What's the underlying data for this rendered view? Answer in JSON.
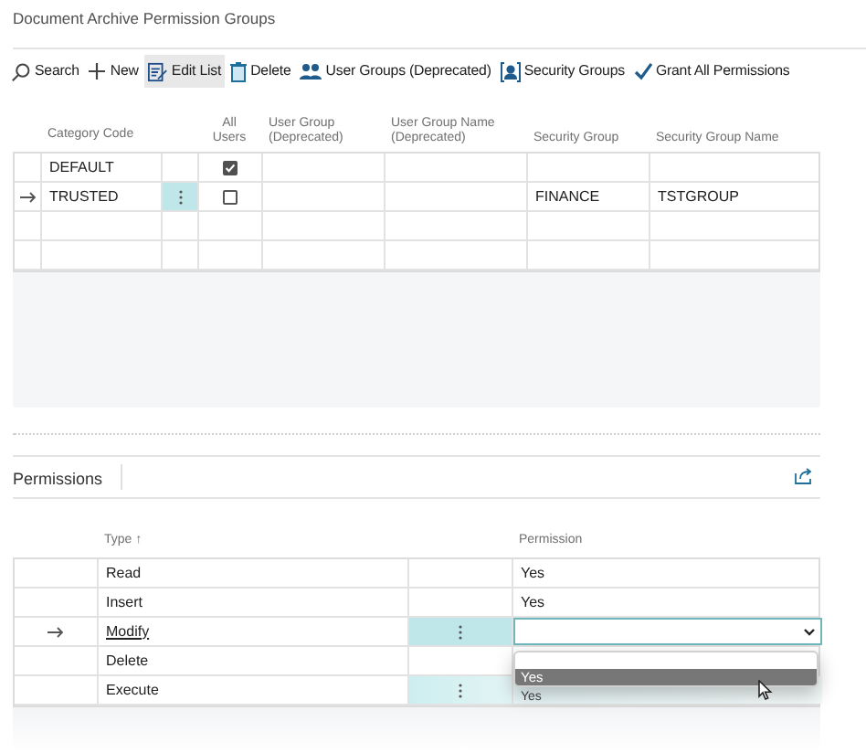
{
  "title": "Document Archive Permission Groups",
  "actions": [
    {
      "label": "Search",
      "selected": false
    },
    {
      "label": "New",
      "selected": false
    },
    {
      "label": "Edit List",
      "selected": true
    },
    {
      "label": "Delete",
      "selected": false
    },
    {
      "label": "User Groups (Deprecated)",
      "selected": false
    },
    {
      "label": "Security Groups",
      "selected": false
    },
    {
      "label": "Grant All Permissions",
      "selected": false
    }
  ],
  "groups": {
    "columns": [
      "Category Code",
      "All Users",
      "User Group (Deprecated)",
      "User Group Name (Deprecated)",
      "Security Group",
      "Security Group Name"
    ],
    "rows": [
      {
        "selected": false,
        "category_code": "DEFAULT",
        "all_users": true
      },
      {
        "selected": true,
        "category_code": "TRUSTED",
        "all_users": false,
        "security_group": "FINANCE",
        "security_group_name": "TSTGROUP"
      },
      {
        "selected": false
      },
      {
        "selected": false
      }
    ]
  },
  "permissions": {
    "title": "Permissions",
    "columns": {
      "type": "Type ↑",
      "permission": "Permission"
    },
    "rows": [
      {
        "type": "Read",
        "permission": "Yes",
        "selected": false,
        "hover": false
      },
      {
        "type": "Insert",
        "permission": "Yes",
        "selected": false,
        "hover": false
      },
      {
        "type": "Modify",
        "selected": true,
        "hover": false,
        "dropdown": {
          "options": [
            {
              "label": "Yes",
              "selected": true
            }
          ]
        }
      },
      {
        "type": "Delete",
        "selected": false,
        "hover": false
      },
      {
        "type": "Execute",
        "permission": "Yes",
        "selected": false,
        "hover": true
      }
    ]
  }
}
